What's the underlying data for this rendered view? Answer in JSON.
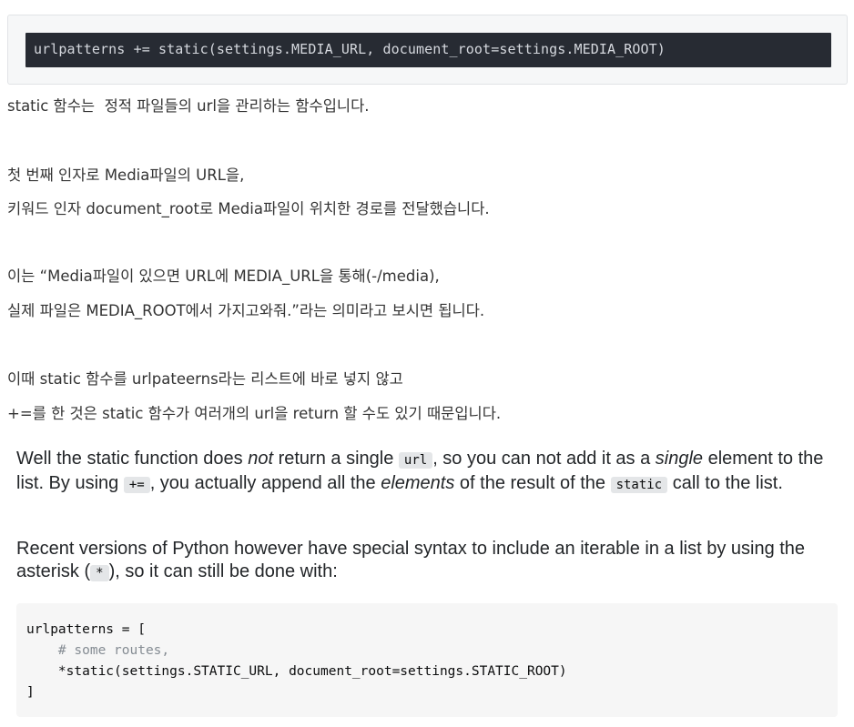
{
  "top_code": "urlpatterns += static(settings.MEDIA_URL, document_root=settings.MEDIA_ROOT)",
  "korean": {
    "p1": "static 함수는  정적 파일들의 url을 관리하는 함수입니다.",
    "p2a": "첫 번째 인자로 Media파일의 URL을,",
    "p2b": "키워드 인자 document_root로 Media파일이 위치한 경로를 전달했습니다.",
    "p3a": "이는 “Media파일이 있으면 URL에 MEDIA_URL을 통해(-/media),",
    "p3b": "실제 파일은 MEDIA_ROOT에서 가지고와줘.”라는 의미라고 보시면 됩니다.",
    "p4a": "이때 static 함수를 urlpateerns라는 리스트에 바로 넣지 않고",
    "p4b": "+=를 한 것은 static 함수가 여러개의 url을 return 할 수도 있기 때문입니다."
  },
  "english": {
    "p1": {
      "t1": "Well the static function does ",
      "em1": "not",
      "t2": " return a single ",
      "code1": "url",
      "t3": ", so you can not add it as a ",
      "em2": "single",
      "t4": " element to the list. By using ",
      "code2": "+=",
      "t5": ", you actually append all the ",
      "em3": "elements",
      "t6": " of the result of the ",
      "code3": "static",
      "t7": " call to the list."
    },
    "p2": {
      "t1": "Recent versions of Python however have special syntax to include an iterable in a list by using the asterisk (",
      "code1": "*",
      "t2": "), so it can still be done with:"
    }
  },
  "bottom_code": {
    "line1": "urlpatterns = [",
    "line2": "    # some routes,",
    "line3": "    *static(settings.STATIC_URL, document_root=settings.STATIC_ROOT)",
    "line4": "]"
  }
}
